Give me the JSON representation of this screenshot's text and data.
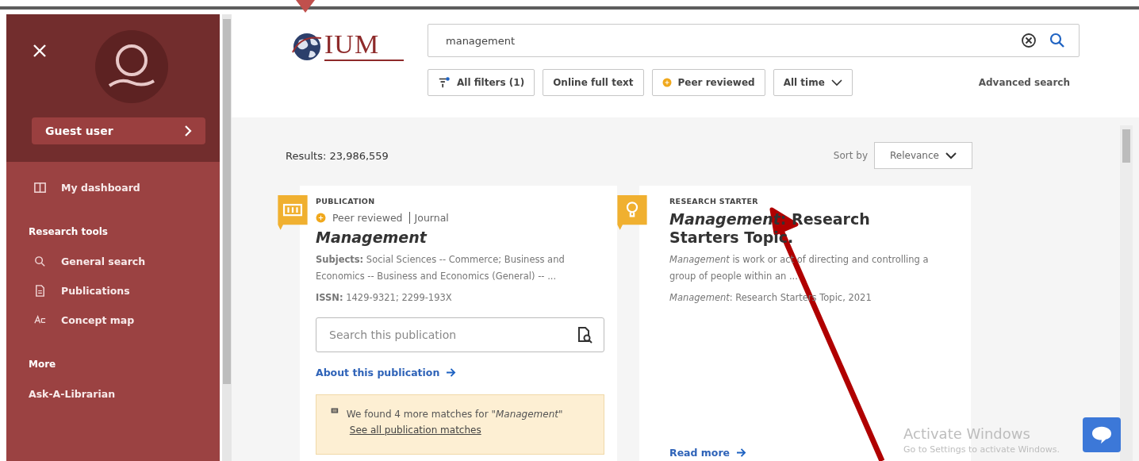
{
  "sidebar": {
    "user": {
      "label": "Guest user"
    },
    "sections": [
      {
        "items": [
          {
            "label": "My dashboard",
            "kind": "dashboard"
          }
        ]
      },
      {
        "heading": "Research tools",
        "items": [
          {
            "label": "General search",
            "kind": "search"
          },
          {
            "label": "Publications",
            "kind": "document"
          },
          {
            "label": "Concept map",
            "kind": "concept"
          }
        ]
      },
      {
        "heading": "More",
        "items": [
          {
            "label": "Ask-A-Librarian",
            "kind": "plain"
          }
        ]
      }
    ]
  },
  "header": {
    "logo": {
      "text": "IUM"
    },
    "search": {
      "value": "management"
    },
    "filters": [
      {
        "label": "All filters (1)",
        "kind": "filters"
      },
      {
        "label": "Online full text",
        "kind": "plain"
      },
      {
        "label": "Peer reviewed",
        "kind": "dot"
      },
      {
        "label": "All time",
        "kind": "dropdown"
      }
    ],
    "advanced_search": "Advanced search"
  },
  "results": {
    "count": "Results: 23,986,559",
    "sort_label": "Sort by",
    "sort_value": "Relevance",
    "cards": [
      {
        "kind": "publication",
        "type": "PUBLICATION",
        "meta": [
          "Peer reviewed",
          "Journal"
        ],
        "title": "*Management*",
        "lines": [
          "**Subjects:** Social Sciences -- Commerce; Business and Economics -- Business and Economics (General) -- ...",
          "**ISSN:** 1429-9321; 2299-193X"
        ],
        "search_placeholder": "Search this publication",
        "link": "About this publication",
        "notice": {
          "text": "We found 4 more matches for \"*Management*\"",
          "link": "See all publication matches"
        }
      },
      {
        "kind": "starter",
        "type": "RESEARCH STARTER",
        "title": "*Management*: Research Starters Topic.",
        "lines": [
          "*Management* is work or act of directing and controlling a group of people within an ...",
          "*Management*: Research Starters Topic, 2021"
        ],
        "link": "Read more"
      }
    ]
  },
  "watermark": {
    "title": "Activate Windows",
    "subtitle": "Go to Settings to activate Windows."
  }
}
